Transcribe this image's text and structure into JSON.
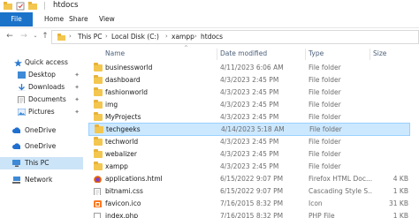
{
  "window": {
    "title": "htdocs"
  },
  "ribbon": {
    "tabs": [
      "File",
      "Home",
      "Share",
      "View"
    ]
  },
  "address": {
    "crumbs": [
      "This PC",
      "Local Disk (C:)",
      "xampp",
      "htdocs"
    ]
  },
  "sidebar": {
    "items": [
      {
        "label": "Quick access",
        "icon": "star-icon",
        "pinned": false
      },
      {
        "label": "Desktop",
        "icon": "desktop-icon",
        "pinned": true
      },
      {
        "label": "Downloads",
        "icon": "download-icon",
        "pinned": true
      },
      {
        "label": "Documents",
        "icon": "documents-icon",
        "pinned": true
      },
      {
        "label": "Pictures",
        "icon": "pictures-icon",
        "pinned": true
      },
      {
        "label": "OneDrive",
        "icon": "cloud-icon",
        "pinned": false
      },
      {
        "label": "OneDrive",
        "icon": "cloud-icon",
        "pinned": false
      },
      {
        "label": "This PC",
        "icon": "computer-icon",
        "pinned": false
      },
      {
        "label": "Network",
        "icon": "network-icon",
        "pinned": false
      }
    ],
    "pin_glyph": "📌"
  },
  "columns": {
    "name": "Name",
    "date": "Date modified",
    "type": "Type",
    "size": "Size"
  },
  "files": [
    {
      "name": "businessworld",
      "date": "4/11/2023 6:06 AM",
      "type": "File folder",
      "size": "",
      "icon": "folder-icon"
    },
    {
      "name": "dashboard",
      "date": "4/3/2023 2:45 PM",
      "type": "File folder",
      "size": "",
      "icon": "folder-icon"
    },
    {
      "name": "fashionworld",
      "date": "4/3/2023 2:45 PM",
      "type": "File folder",
      "size": "",
      "icon": "folder-icon"
    },
    {
      "name": "img",
      "date": "4/3/2023 2:45 PM",
      "type": "File folder",
      "size": "",
      "icon": "folder-icon"
    },
    {
      "name": "MyProjects",
      "date": "4/3/2023 2:45 PM",
      "type": "File folder",
      "size": "",
      "icon": "folder-icon"
    },
    {
      "name": "techgeeks",
      "date": "4/14/2023 5:18 AM",
      "type": "File folder",
      "size": "",
      "icon": "folder-icon"
    },
    {
      "name": "techworld",
      "date": "4/3/2023 2:45 PM",
      "type": "File folder",
      "size": "",
      "icon": "folder-icon"
    },
    {
      "name": "webalizer",
      "date": "4/3/2023 2:45 PM",
      "type": "File folder",
      "size": "",
      "icon": "folder-icon"
    },
    {
      "name": "xampp",
      "date": "4/3/2023 2:45 PM",
      "type": "File folder",
      "size": "",
      "icon": "folder-icon"
    },
    {
      "name": "applications.html",
      "date": "6/15/2022 9:07 PM",
      "type": "Firefox HTML Doc...",
      "size": "4 KB",
      "icon": "html-file-icon"
    },
    {
      "name": "bitnami.css",
      "date": "6/15/2022 9:07 PM",
      "type": "Cascading Style S...",
      "size": "1 KB",
      "icon": "css-file-icon"
    },
    {
      "name": "favicon.ico",
      "date": "7/16/2015 8:32 PM",
      "type": "Icon",
      "size": "31 KB",
      "icon": "ico-file-icon"
    },
    {
      "name": "index.php",
      "date": "7/16/2015 8:32 PM",
      "type": "PHP File",
      "size": "1 KB",
      "icon": "php-file-icon"
    }
  ],
  "selected_index": 5,
  "colors": {
    "accent": "#1a73c9",
    "selection": "#cce8ff",
    "folder": "#f3c64f"
  }
}
